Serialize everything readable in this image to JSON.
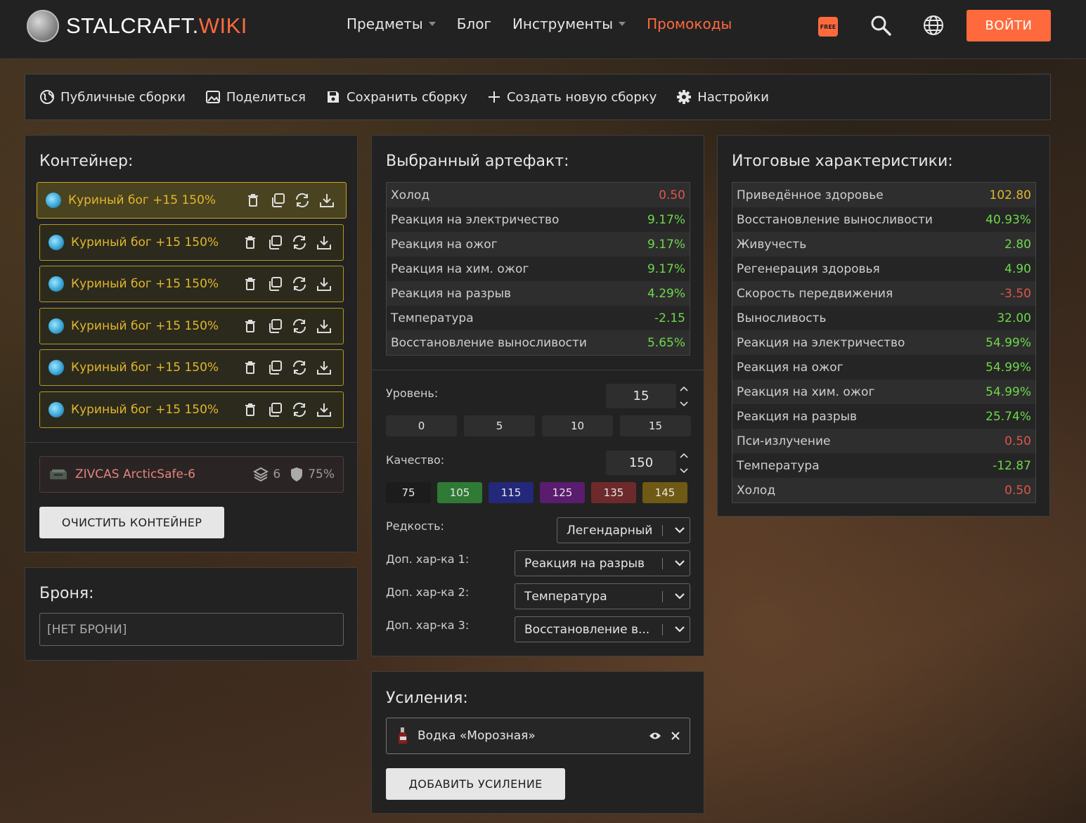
{
  "header": {
    "logo_main": "STALCRAFT.",
    "logo_accent": "WIKI",
    "nav": [
      {
        "label": "Предметы",
        "has_dropdown": true
      },
      {
        "label": "Блог",
        "has_dropdown": false
      },
      {
        "label": "Инструменты",
        "has_dropdown": true
      },
      {
        "label": "Промокоды",
        "has_dropdown": false
      }
    ],
    "free_badge": "FREE",
    "login_label": "ВОЙТИ",
    "accent_color": "#ff6a3d"
  },
  "toolbar": {
    "items": [
      {
        "label": "Публичные сборки",
        "icon": "globe-icon"
      },
      {
        "label": "Поделиться",
        "icon": "image-icon"
      },
      {
        "label": "Сохранить сборку",
        "icon": "save-icon"
      },
      {
        "label": "Создать новую сборку",
        "icon": "plus-icon"
      },
      {
        "label": "Настройки",
        "icon": "gear-icon"
      }
    ]
  },
  "container_panel": {
    "title": "Контейнер:",
    "artifacts": [
      {
        "name": "Куриный бог +15 150%"
      },
      {
        "name": "Куриный бог +15 150%"
      },
      {
        "name": "Куриный бог +15 150%"
      },
      {
        "name": "Куриный бог +15 150%"
      },
      {
        "name": "Куриный бог +15 150%"
      },
      {
        "name": "Куриный бог +15 150%"
      }
    ],
    "container": {
      "name": "ZIVCAS ArcticSafe-6",
      "slots": "6",
      "protection": "75%"
    },
    "clear_label": "ОЧИСТИТЬ КОНТЕЙНЕР"
  },
  "armor_panel": {
    "title": "Броня:",
    "value": "[НЕТ БРОНИ]"
  },
  "artifact_panel": {
    "title": "Выбранный артефакт:",
    "stats": [
      {
        "label": "Холод",
        "value": "0.50",
        "tone": "red"
      },
      {
        "label": "Реакция на электричество",
        "value": "9.17%",
        "tone": "green"
      },
      {
        "label": "Реакция на ожог",
        "value": "9.17%",
        "tone": "green"
      },
      {
        "label": "Реакция на хим. ожог",
        "value": "9.17%",
        "tone": "green"
      },
      {
        "label": "Реакция на разрыв",
        "value": "4.29%",
        "tone": "green"
      },
      {
        "label": "Температура",
        "value": "-2.15",
        "tone": "green"
      },
      {
        "label": "Восстановление выносливости",
        "value": "5.65%",
        "tone": "green"
      }
    ],
    "level_label": "Уровень:",
    "level_value": "15",
    "level_presets": [
      "0",
      "5",
      "10",
      "15"
    ],
    "quality_label": "Качество:",
    "quality_value": "150",
    "quality_presets": [
      {
        "label": "75",
        "color": "#1c1c1c"
      },
      {
        "label": "105",
        "color": "#2f7a35"
      },
      {
        "label": "115",
        "color": "#23287a"
      },
      {
        "label": "125",
        "color": "#5a1c6e"
      },
      {
        "label": "135",
        "color": "#6e2a2a"
      },
      {
        "label": "145",
        "color": "#6e5a14"
      }
    ],
    "rarity_label": "Редкость:",
    "rarity_value": "Легендарный",
    "extra1_label": "Доп. хар-ка 1:",
    "extra1_value": "Реакция на разрыв",
    "extra2_label": "Доп. хар-ка 2:",
    "extra2_value": "Температура",
    "extra3_label": "Доп. хар-ка 3:",
    "extra3_value": "Восстановление в..."
  },
  "boosts_panel": {
    "title": "Усиления:",
    "boost_name": "Водка «Морозная»",
    "add_label": "ДОБАВИТЬ УСИЛЕНИЕ"
  },
  "totals_panel": {
    "title": "Итоговые характеристики:",
    "stats": [
      {
        "label": "Приведённое здоровье",
        "value": "102.80",
        "tone": "yellow"
      },
      {
        "label": "Восстановление выносливости",
        "value": "40.93%",
        "tone": "green"
      },
      {
        "label": "Живучесть",
        "value": "2.80",
        "tone": "green"
      },
      {
        "label": "Регенерация здоровья",
        "value": "4.90",
        "tone": "green"
      },
      {
        "label": "Скорость передвижения",
        "value": "-3.50",
        "tone": "red"
      },
      {
        "label": "Выносливость",
        "value": "32.00",
        "tone": "green"
      },
      {
        "label": "Реакция на электричество",
        "value": "54.99%",
        "tone": "green"
      },
      {
        "label": "Реакция на ожог",
        "value": "54.99%",
        "tone": "green"
      },
      {
        "label": "Реакция на хим. ожог",
        "value": "54.99%",
        "tone": "green"
      },
      {
        "label": "Реакция на разрыв",
        "value": "25.74%",
        "tone": "green"
      },
      {
        "label": "Пси-излучение",
        "value": "0.50",
        "tone": "red"
      },
      {
        "label": "Температура",
        "value": "-12.87",
        "tone": "green"
      },
      {
        "label": "Холод",
        "value": "0.50",
        "tone": "red"
      }
    ]
  }
}
